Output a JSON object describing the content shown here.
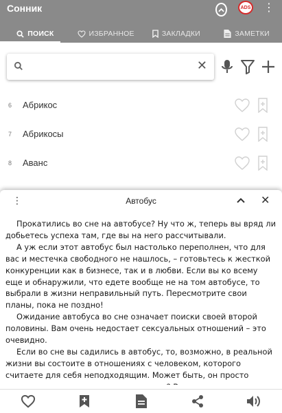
{
  "app": {
    "title": "Сонник"
  },
  "colors": {
    "appbar": "#8a8a8a",
    "icon": "#555555",
    "muted_icon": "#d0d0d0"
  },
  "tabs": [
    {
      "label": "Поиск",
      "icon": "search-icon",
      "active": true
    },
    {
      "label": "Избранное",
      "icon": "heart-icon",
      "active": false
    },
    {
      "label": "Закладки",
      "icon": "bookmark-icon",
      "active": false
    },
    {
      "label": "Заметки",
      "icon": "note-icon",
      "active": false
    }
  ],
  "search": {
    "value": "",
    "placeholder": ""
  },
  "list": [
    {
      "num": "6",
      "word": "Абрикос"
    },
    {
      "num": "7",
      "word": "Абрикосы"
    },
    {
      "num": "8",
      "word": "Аванс"
    }
  ],
  "sheet": {
    "title": "Автобус",
    "paragraphs": [
      "Прокатились во сне на автобусе? Ну что ж, теперь вы вряд ли добьетесь успеха там, где вы на него рассчитывали.",
      "А уж если этот автобус был настолько переполнен, что для вас и местечка свободного не нашлось, – готовьтесь к жесткой конкуренции как в бизнесе, так и в любви. Если вы ко всему еще и обнаружили, что едете вообще не на том автобусе, то выбрали в жизни неправильный путь. Пересмотрите свои планы, пока не поздно!",
      "Ожидание автобуса во сне означает поиски своей второй половины. Вам очень недостает сексуальных отношений – это очевидно.",
      "Если во сне вы садились в автобус, то, возможно, в реальной жизни вы состоите в отношениях с человеком, которого считаете для себя неподходящим. Может быть, он просто встретился вам в минуты одиночества? Ведь на"
    ]
  }
}
